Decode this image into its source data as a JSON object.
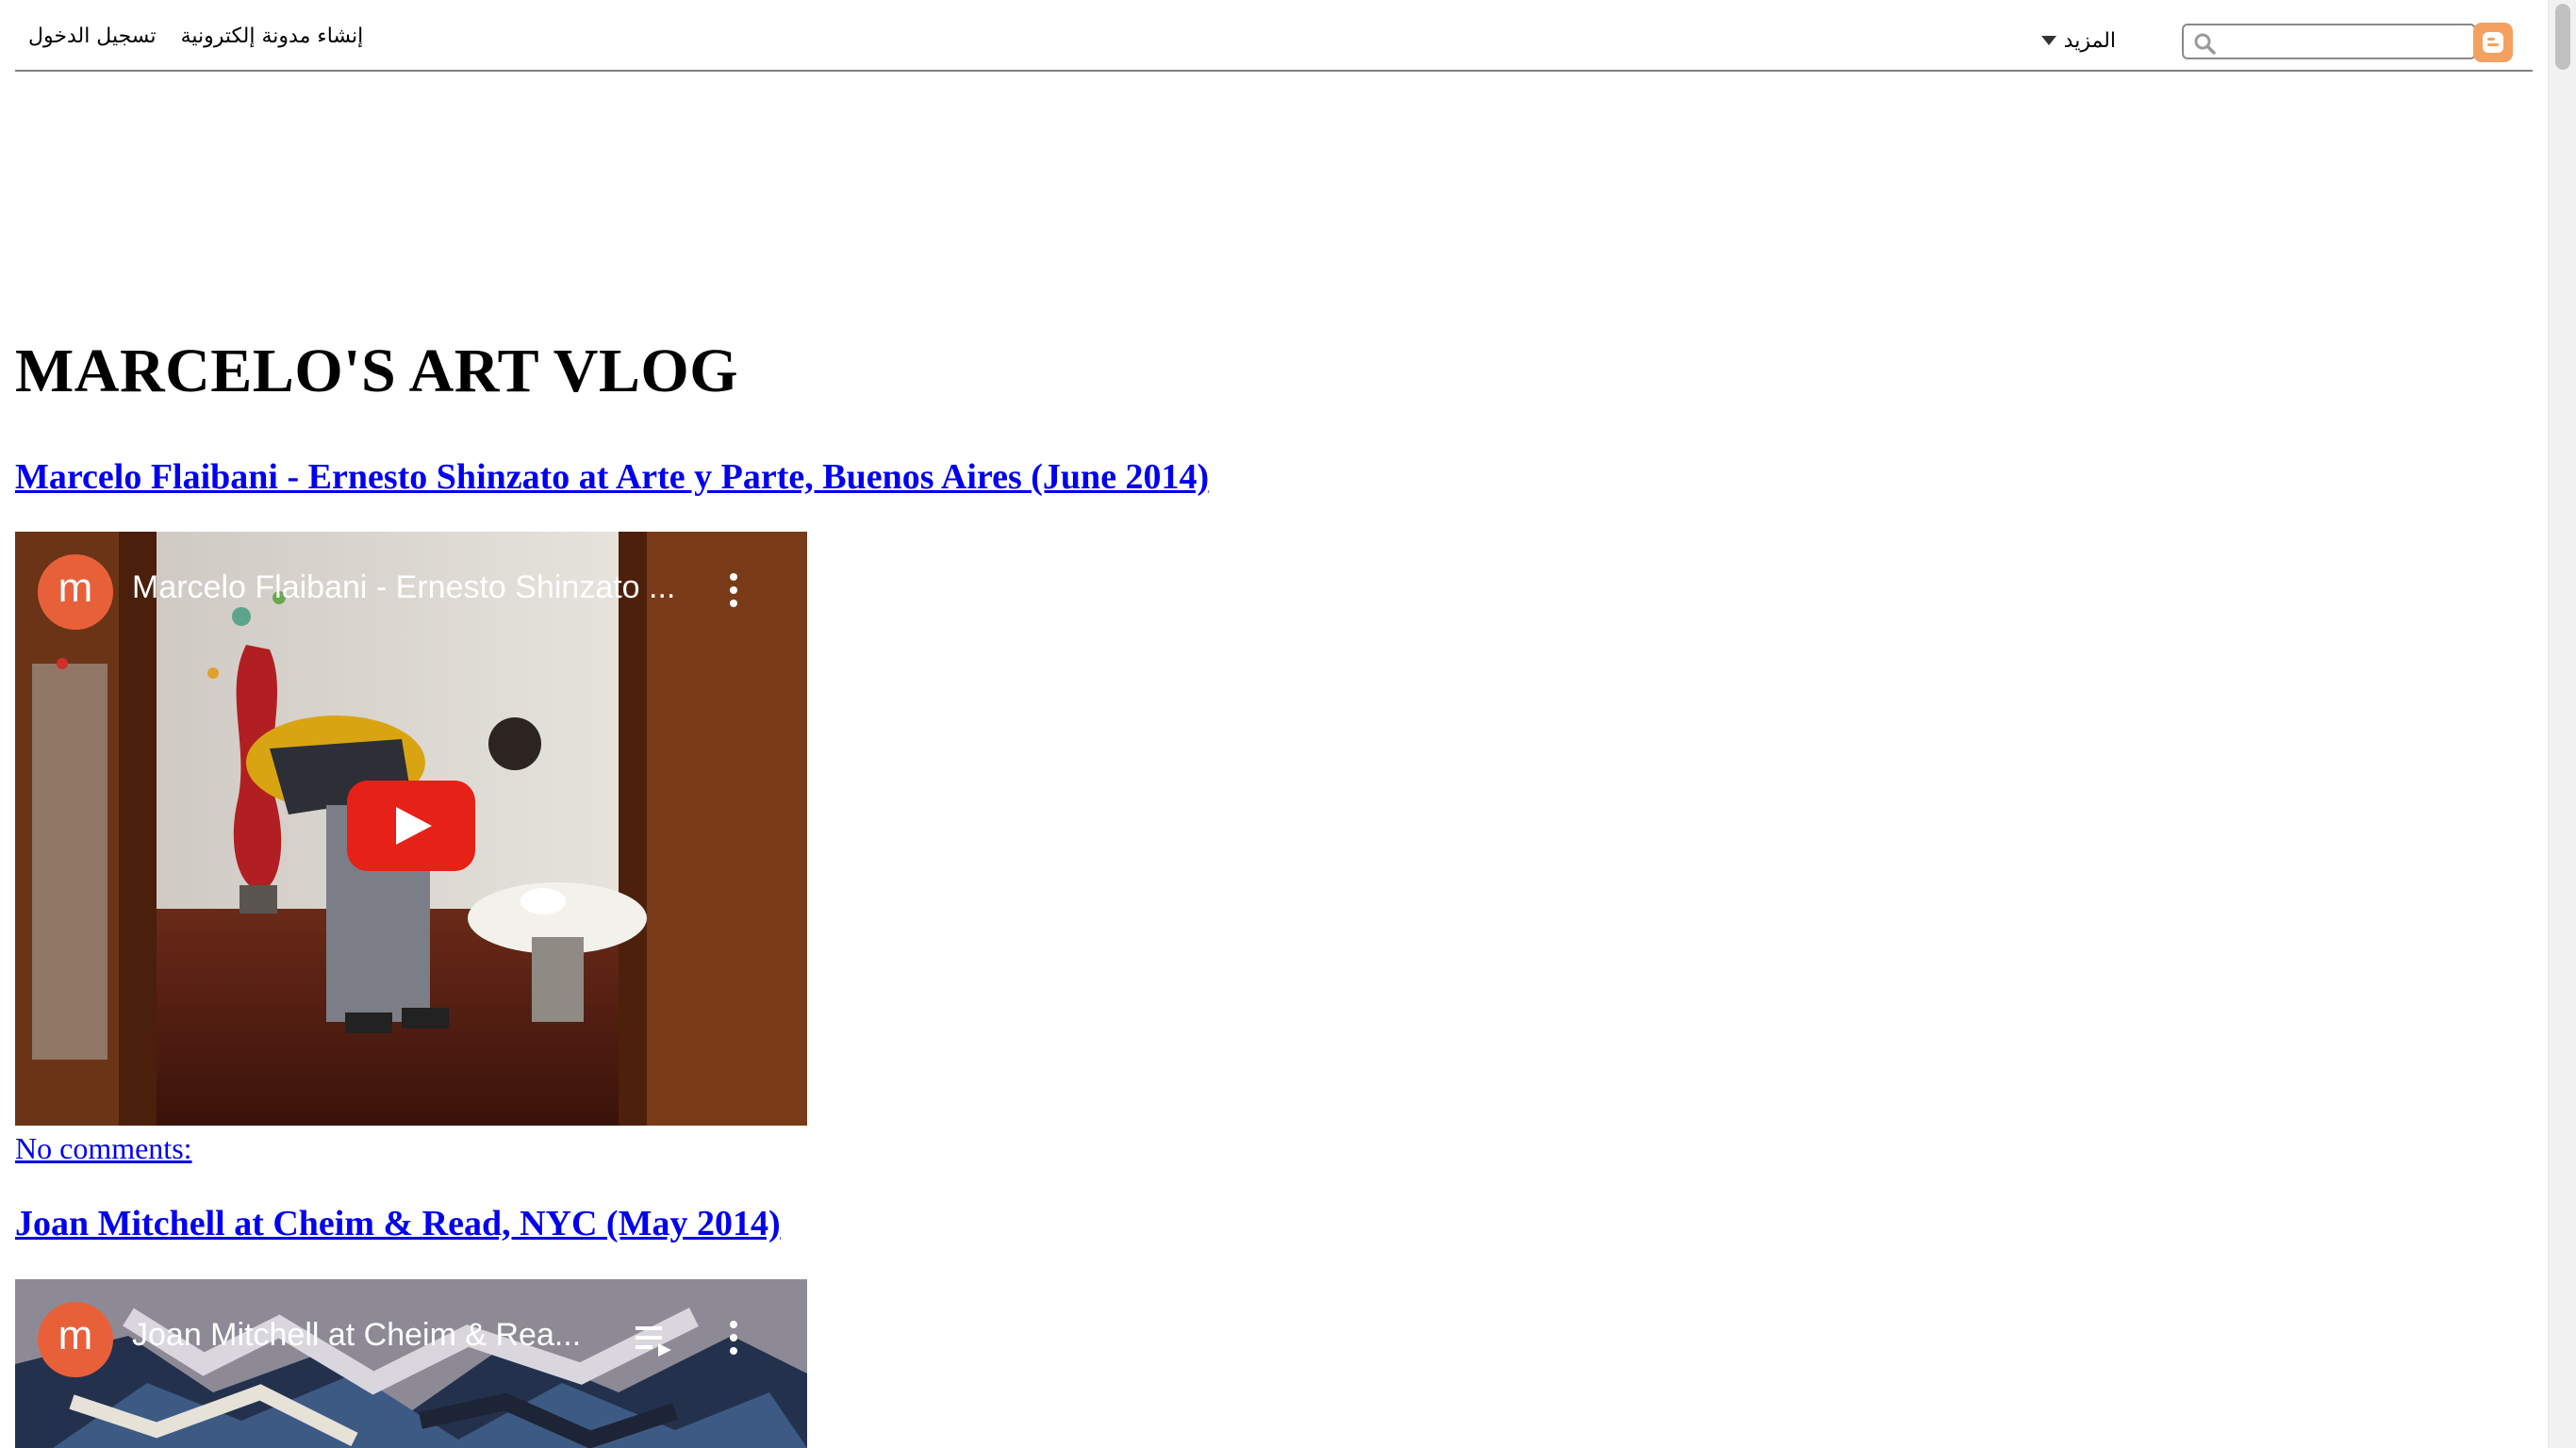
{
  "navbar": {
    "search_placeholder": "",
    "more_label": "المزيد",
    "create_blog_label": "إنشاء مدونة إلكترونية",
    "sign_in_label": "تسجيل الدخول"
  },
  "blog": {
    "title": "MARCELO'S ART VLOG"
  },
  "posts": [
    {
      "title": "Marcelo Flaibani - Ernesto Shinzato at Arte y Parte, Buenos Aires (June 2014)",
      "video": {
        "channel_initial": "m",
        "title": "Marcelo Flaibani - Ernesto Shinzato ..."
      },
      "comments_label": "No comments:"
    },
    {
      "title": "Joan Mitchell at Cheim & Read, NYC (May 2014)",
      "video": {
        "channel_initial": "m",
        "title": "Joan Mitchell at Cheim & Rea..."
      }
    }
  ],
  "colors": {
    "link": "#0000ee",
    "blogger_orange": "#f4a160",
    "youtube_red": "#e62117",
    "avatar": "#e8603a"
  }
}
